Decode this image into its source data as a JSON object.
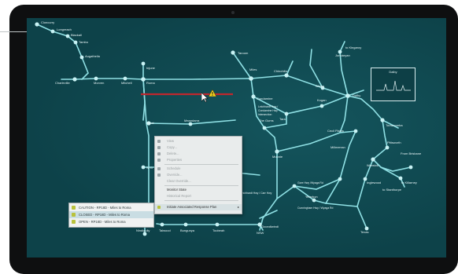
{
  "map": {
    "towns": {
      "cloncurry": "Cloncurry",
      "longreach": "Longreach",
      "blackall": "Blackall",
      "tambo": "Tambo",
      "augathella": "Augathella",
      "charleville": "Charleville",
      "morven": "Morven",
      "mitchell": "Mitchell",
      "injune": "Injune",
      "roma": "Roma",
      "taroom": "Taroom",
      "miles": "Miles",
      "chinchilla": "Chinchilla",
      "kingaroy": "to Kingaroy",
      "jondaryan": "Jondaryan",
      "warra": "Warra",
      "dalby": "Dalby",
      "condamine": "Condamine",
      "gums": "The Gums",
      "tara": "Tara",
      "kogan": "Kogan",
      "surat": "Surat",
      "meandarra": "Meandarra",
      "moonie": "Moonie",
      "cecil_plains": "Cecil Plains",
      "millmerran": "Millmerran",
      "toowoomba": "Toowoomba",
      "pittsworth": "Pittsworth",
      "brisbane": "From Brisbane",
      "warwick": "Warwick",
      "killarney": "to Killarney",
      "inglewood": "Inglewood",
      "stanthorpe": "to Stanthorpe",
      "goondiwindi": "Goondiwindi",
      "texas": "Texas",
      "yelarbon": "Yelarbon",
      "gore_hwy": "Gore Hwy /Wyaga Rd",
      "cunningham": "Cunningham Hwy / Wyaga Rd",
      "leichhardt": "Leichhardt Hwy / Carr Hwy",
      "nsw": "NSW",
      "st_george": "St G",
      "nindigully": "Nindigully",
      "talwood": "Talwood",
      "bungunya": "Bungunya",
      "toobeah": "Toobeah",
      "condamine_note": "Leichhardt Hwy / Condamine Hwy intersection"
    }
  },
  "legend": {
    "title": "Dalby"
  },
  "context_menu": {
    "items": [
      {
        "label": "View",
        "enabled": false
      },
      {
        "label": "Copy...",
        "enabled": false
      },
      {
        "label": "Delete...",
        "enabled": false
      },
      {
        "label": "Properties",
        "enabled": false
      },
      {
        "label": "Schedule",
        "enabled": false
      },
      {
        "label": "Override...",
        "enabled": false
      },
      {
        "label": "Clear Override...",
        "enabled": false
      },
      {
        "label": "Monitor State",
        "enabled": true
      },
      {
        "label": "Historical Report",
        "enabled": false
      },
      {
        "label": "Initiate Associated Response Plan",
        "enabled": true,
        "submenu": true
      }
    ]
  },
  "response_plans": [
    {
      "label": "CAUTION - RP18D - Miles to Roma"
    },
    {
      "label": "CLOSED - RP18D - Miles to Roma"
    },
    {
      "label": "OPEN - RP18D - Miles to Roma"
    }
  ],
  "colors": {
    "road": "#8fe0e4",
    "node": "#c8f2f4",
    "alert_road": "#c0272d",
    "warning": "#f2d21a",
    "screen": "#0d4249"
  }
}
